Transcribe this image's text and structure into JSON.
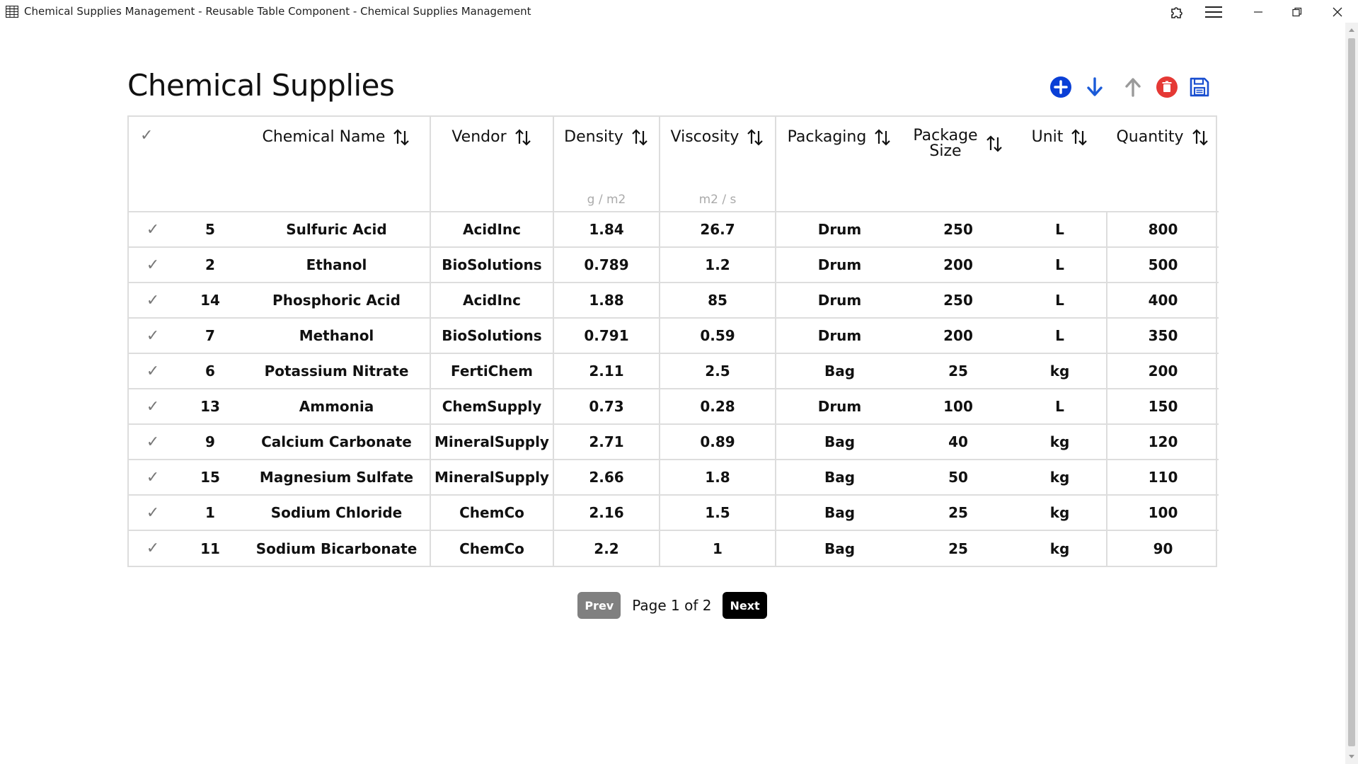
{
  "window": {
    "title": "Chemical Supplies Management - Reusable Table Component - Chemical Supplies Management"
  },
  "page": {
    "title": "Chemical Supplies"
  },
  "toolbar": {
    "icons": [
      "add-icon",
      "arrow-down-icon",
      "arrow-up-icon",
      "delete-icon",
      "save-icon"
    ],
    "colors": {
      "add": "#0a3fd6",
      "down": "#1a5ad8",
      "up": "#9a9a9a",
      "delete": "#e53935",
      "save": "#1a4fd0"
    }
  },
  "table": {
    "headers": {
      "check": "✓",
      "name": "Chemical Name",
      "vendor": "Vendor",
      "density": "Density",
      "density_unit": "g / m2",
      "viscosity": "Viscosity",
      "viscosity_unit": "m2 / s",
      "packaging": "Packaging",
      "package_size_1": "Package",
      "package_size_2": "Size",
      "unit": "Unit",
      "quantity": "Quantity"
    },
    "rows": [
      {
        "check": "✓",
        "id": "5",
        "name": "Sulfuric Acid",
        "vendor": "AcidInc",
        "density": "1.84",
        "viscosity": "26.7",
        "packaging": "Drum",
        "size": "250",
        "unit": "L",
        "quantity": "800"
      },
      {
        "check": "✓",
        "id": "2",
        "name": "Ethanol",
        "vendor": "BioSolutions",
        "density": "0.789",
        "viscosity": "1.2",
        "packaging": "Drum",
        "size": "200",
        "unit": "L",
        "quantity": "500"
      },
      {
        "check": "✓",
        "id": "14",
        "name": "Phosphoric Acid",
        "vendor": "AcidInc",
        "density": "1.88",
        "viscosity": "85",
        "packaging": "Drum",
        "size": "250",
        "unit": "L",
        "quantity": "400"
      },
      {
        "check": "✓",
        "id": "7",
        "name": "Methanol",
        "vendor": "BioSolutions",
        "density": "0.791",
        "viscosity": "0.59",
        "packaging": "Drum",
        "size": "200",
        "unit": "L",
        "quantity": "350"
      },
      {
        "check": "✓",
        "id": "6",
        "name": "Potassium Nitrate",
        "vendor": "FertiChem",
        "density": "2.11",
        "viscosity": "2.5",
        "packaging": "Bag",
        "size": "25",
        "unit": "kg",
        "quantity": "200"
      },
      {
        "check": "✓",
        "id": "13",
        "name": "Ammonia",
        "vendor": "ChemSupply",
        "density": "0.73",
        "viscosity": "0.28",
        "packaging": "Drum",
        "size": "100",
        "unit": "L",
        "quantity": "150"
      },
      {
        "check": "✓",
        "id": "9",
        "name": "Calcium Carbonate",
        "vendor": "MineralSupply",
        "density": "2.71",
        "viscosity": "0.89",
        "packaging": "Bag",
        "size": "40",
        "unit": "kg",
        "quantity": "120"
      },
      {
        "check": "✓",
        "id": "15",
        "name": "Magnesium Sulfate",
        "vendor": "MineralSupply",
        "density": "2.66",
        "viscosity": "1.8",
        "packaging": "Bag",
        "size": "50",
        "unit": "kg",
        "quantity": "110"
      },
      {
        "check": "✓",
        "id": "1",
        "name": "Sodium Chloride",
        "vendor": "ChemCo",
        "density": "2.16",
        "viscosity": "1.5",
        "packaging": "Bag",
        "size": "25",
        "unit": "kg",
        "quantity": "100"
      },
      {
        "check": "✓",
        "id": "11",
        "name": "Sodium Bicarbonate",
        "vendor": "ChemCo",
        "density": "2.2",
        "viscosity": "1",
        "packaging": "Bag",
        "size": "25",
        "unit": "kg",
        "quantity": "90"
      }
    ]
  },
  "pagination": {
    "prev_label": "Prev",
    "info": "Page 1 of 2",
    "next_label": "Next"
  }
}
